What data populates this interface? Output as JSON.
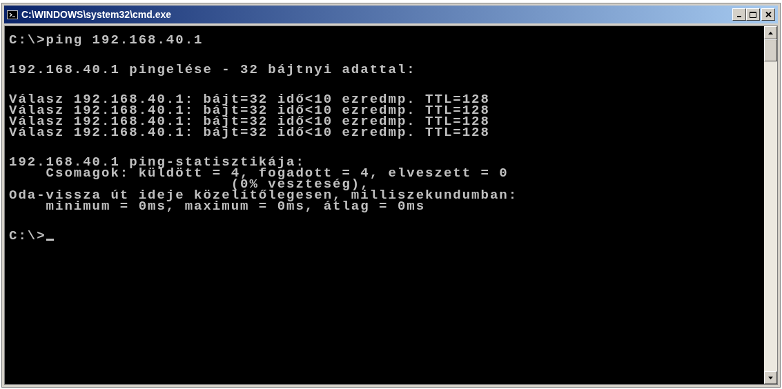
{
  "window": {
    "title": "C:\\WINDOWS\\system32\\cmd.exe"
  },
  "console": {
    "blocks": [
      [
        "C:\\>ping 192.168.40.1"
      ],
      [
        "192.168.40.1 pingelése - 32 bájtnyi adattal:"
      ],
      [
        "Válasz 192.168.40.1: bájt=32 idő<10 ezredmp. TTL=128",
        "Válasz 192.168.40.1: bájt=32 idő<10 ezredmp. TTL=128",
        "Válasz 192.168.40.1: bájt=32 idő<10 ezredmp. TTL=128",
        "Válasz 192.168.40.1: bájt=32 idő<10 ezredmp. TTL=128"
      ],
      [
        "192.168.40.1 ping-statisztikája:",
        "    Csomagok: küldött = 4, fogadott = 4, elveszett = 0",
        "                        (0% veszteség),",
        "Oda-vissza út ideje közelítőlegesen, milliszekundumban:",
        "    minimum = 0ms, maximum = 0ms, átlag = 0ms"
      ]
    ],
    "prompt": "C:\\>"
  }
}
